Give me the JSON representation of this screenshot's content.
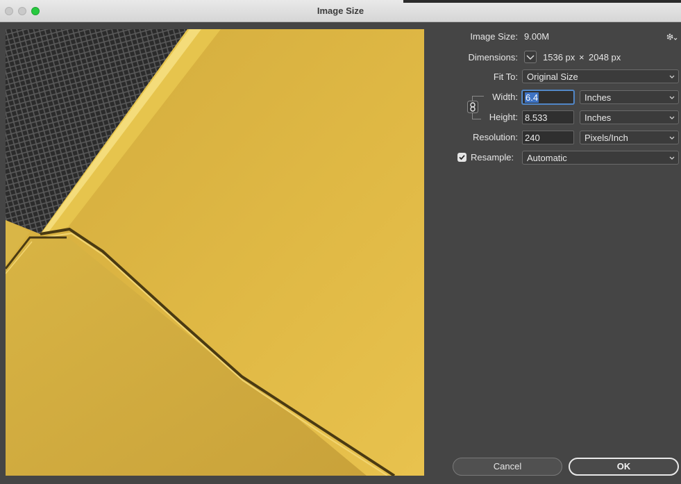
{
  "window": {
    "title": "Image Size"
  },
  "image_size": {
    "label": "Image Size:",
    "value": "9.00M"
  },
  "dimensions": {
    "label": "Dimensions:",
    "width": "1536 px",
    "times": "×",
    "height": "2048 px"
  },
  "fit_to": {
    "label": "Fit To:",
    "value": "Original Size"
  },
  "width": {
    "label": "Width:",
    "value": "6.4",
    "unit": "Inches"
  },
  "height": {
    "label": "Height:",
    "value": "8.533",
    "unit": "Inches"
  },
  "resolution": {
    "label": "Resolution:",
    "value": "240",
    "unit": "Pixels/Inch"
  },
  "resample": {
    "label": "Resample:",
    "checked": true,
    "value": "Automatic"
  },
  "buttons": {
    "cancel": "Cancel",
    "ok": "OK"
  },
  "icons": {
    "gear": "gear-icon",
    "chain": "chain-link-icon",
    "chevron": "chevron-down-icon"
  },
  "colors": {
    "dialog_bg": "#454545",
    "preview_yellow": "#e0b741",
    "focus_blue": "#3e73c4",
    "close_green": "#27c93f"
  }
}
